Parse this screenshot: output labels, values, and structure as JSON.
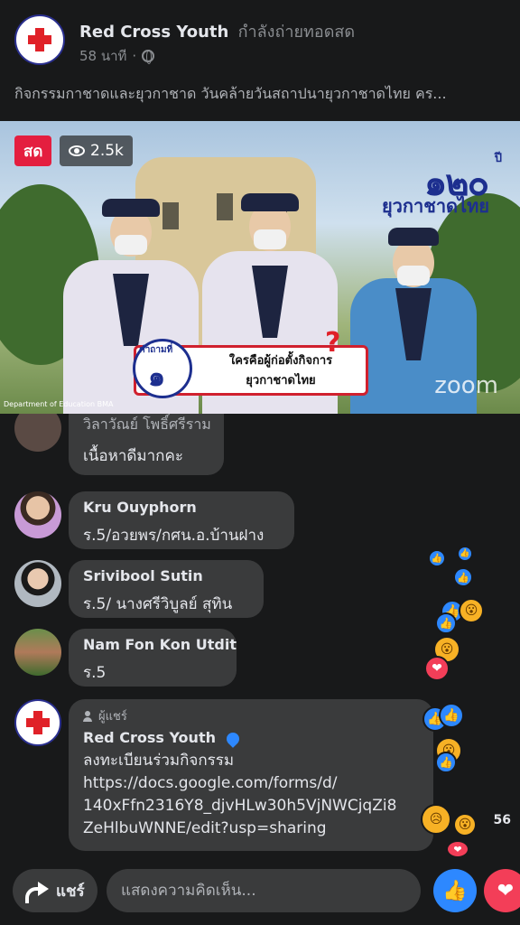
{
  "header": {
    "page_name": "Red Cross Youth",
    "status": "กำลังถ่ายทอดสด",
    "time_ago": "58 นาที",
    "separator": "·"
  },
  "caption": "กิจกรรมกาชาดและยุวกาชาด วันคล้ายวันสถาปนายุวกาชาดไทย คร...",
  "video": {
    "live_label": "สด",
    "view_count": "2.5k",
    "logo_number": "๑๒๐",
    "logo_suffix": "ปี",
    "logo_text": "ยุวกาชาดไทย",
    "question_label": "คำถามที่",
    "question_number": "๑",
    "question_line1": "ใครคือผู้ก่อตั้งกิจการ",
    "question_line2": "ยุวกาชาดไทย",
    "question_mark": "?",
    "credit": "Department of Education BMA",
    "watermark": "zoom"
  },
  "comments": [
    {
      "name": "วิลาวัณย์ โพธิ์ศรีราม",
      "text": "เนื้อหาดีมากคะ"
    },
    {
      "name": "Kru Ouyphorn",
      "text": "ร.5/อวยพร/กศน.อ.บ้านฝาง"
    },
    {
      "name": "Srivibool Sutin",
      "text": "ร.5/ นางศรีวิบูลย์  สุทิน"
    },
    {
      "name": "Nam Fon Kon Utdit",
      "text": "ร.5"
    }
  ],
  "pinned_comment": {
    "shared_label": "ผู้แชร์",
    "name": "Red Cross Youth",
    "line1": "ลงทะเบียนร่วมกิจกรรม",
    "line2": "https://docs.google.com/forms/d/",
    "line3": "140xFfn2316Y8_djvHLw30h5VjNWCjqZi8",
    "line4": "ZeHlbuWNNE/edit?usp=sharing"
  },
  "reactions": {
    "count": "56"
  },
  "bottom_bar": {
    "share_label": "แชร์",
    "comment_placeholder": "แสดงความคิดเห็น..."
  },
  "colors": {
    "background": "#18191a",
    "bubble": "#3a3b3c",
    "live_red": "#e41e3f",
    "like_blue": "#2d88ff",
    "love_red": "#f33e58",
    "wow_yellow": "#f7b125"
  },
  "icons": [
    "red-cross-icon",
    "globe-icon",
    "eye-icon",
    "share-person-icon",
    "pin-icon",
    "share-arrow-icon",
    "like-icon",
    "heart-icon",
    "wow-icon"
  ]
}
